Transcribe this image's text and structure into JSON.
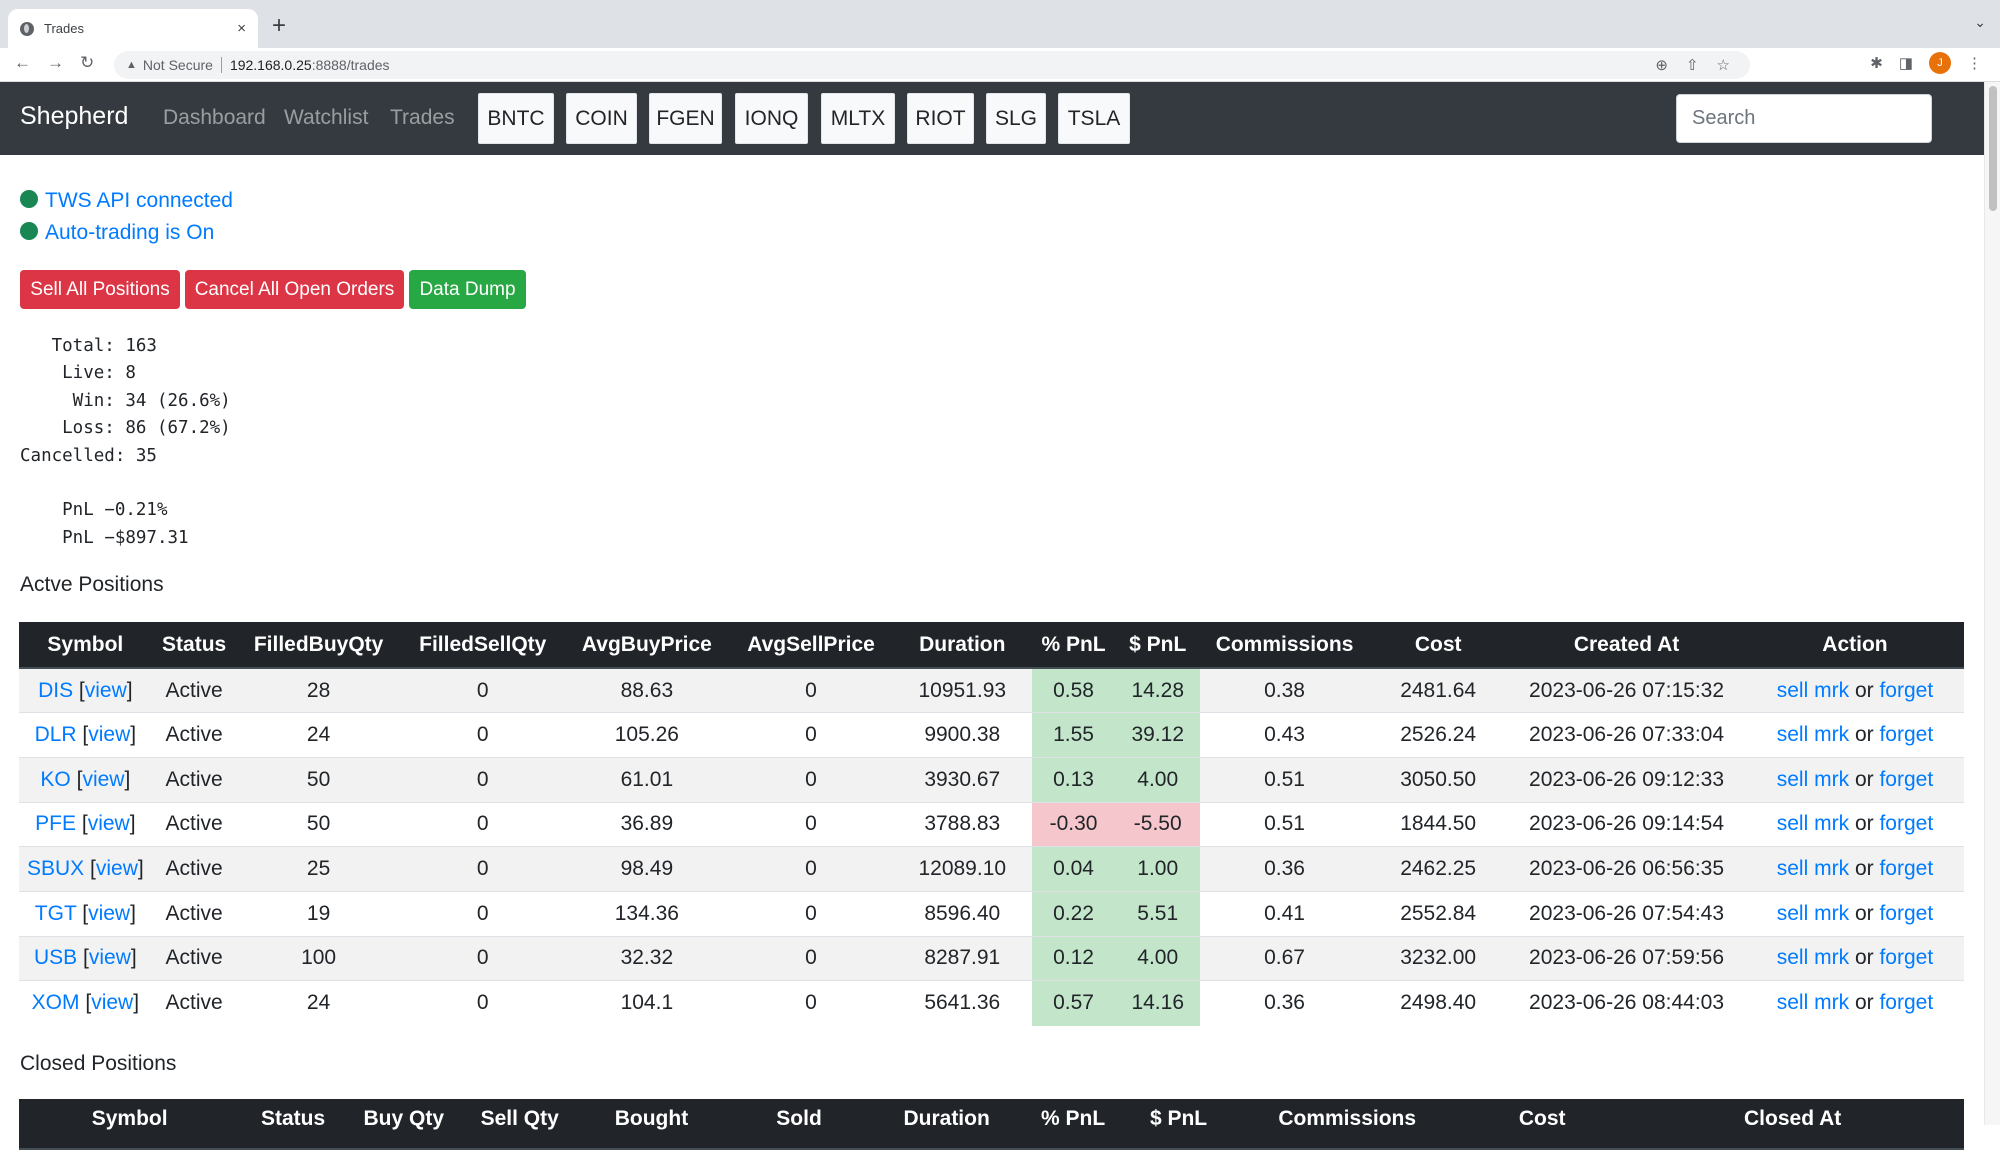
{
  "browser": {
    "tab_title": "Trades",
    "tab_close": "×",
    "new_tab": "+",
    "tab_menu": "⌄",
    "back": "←",
    "forward": "→",
    "reload": "↻",
    "security_icon": "▲",
    "security_label": "Not Secure",
    "url_host": "192.168.0.25",
    "url_rest": ":8888/trades",
    "zoom_icon": "⊕",
    "share_icon": "⇧",
    "star_icon": "☆",
    "extensions_icon": "✱",
    "sidepanel_icon": "◨",
    "profile_initial": "J",
    "menu_icon": "⋮"
  },
  "navbar": {
    "brand": "Shepherd",
    "links": [
      "Dashboard",
      "Watchlist",
      "Trades"
    ],
    "tickers": [
      "BNTC",
      "COIN",
      "FGEN",
      "IONQ",
      "MLTX",
      "RIOT",
      "SLG",
      "TSLA"
    ],
    "search_placeholder": "Search"
  },
  "status": {
    "api": "TWS API connected",
    "autotrading": "Auto-trading is On",
    "indicator_color": "#198754"
  },
  "actions": {
    "sell_all": "Sell All Positions",
    "cancel_all": "Cancel All Open Orders",
    "data_dump": "Data Dump"
  },
  "stats": {
    "total": "   Total: 163",
    "live": "    Live: 8",
    "win": "     Win: 34 (26.6%)",
    "loss": "    Loss: 86 (67.2%)",
    "cancelled": "Cancelled: 35",
    "pnl_pct": "    PnL −0.21%",
    "pnl_usd": "    PnL −$897.31"
  },
  "active": {
    "title": "Actve Positions",
    "columns": [
      "Symbol",
      "Status",
      "FilledBuyQty",
      "FilledSellQty",
      "AvgBuyPrice",
      "AvgSellPrice",
      "Duration",
      "% PnL",
      "$ PnL",
      "Commissions",
      "Cost",
      "Created At",
      "Action"
    ],
    "view_label": "view",
    "sell_label": "sell mrk",
    "or_label": "or",
    "forget_label": "forget",
    "rows": [
      {
        "symbol": "DIS",
        "status": "Active",
        "buy_qty": "28",
        "sell_qty": "0",
        "avg_buy": "88.63",
        "avg_sell": "0",
        "duration": "10951.93",
        "pnl_pct": "0.58",
        "pnl_usd": "14.28",
        "commissions": "0.38",
        "cost": "2481.64",
        "created": "2023-06-26 07:15:32"
      },
      {
        "symbol": "DLR",
        "status": "Active",
        "buy_qty": "24",
        "sell_qty": "0",
        "avg_buy": "105.26",
        "avg_sell": "0",
        "duration": "9900.38",
        "pnl_pct": "1.55",
        "pnl_usd": "39.12",
        "commissions": "0.43",
        "cost": "2526.24",
        "created": "2023-06-26 07:33:04"
      },
      {
        "symbol": "KO",
        "status": "Active",
        "buy_qty": "50",
        "sell_qty": "0",
        "avg_buy": "61.01",
        "avg_sell": "0",
        "duration": "3930.67",
        "pnl_pct": "0.13",
        "pnl_usd": "4.00",
        "commissions": "0.51",
        "cost": "3050.50",
        "created": "2023-06-26 09:12:33"
      },
      {
        "symbol": "PFE",
        "status": "Active",
        "buy_qty": "50",
        "sell_qty": "0",
        "avg_buy": "36.89",
        "avg_sell": "0",
        "duration": "3788.83",
        "pnl_pct": "-0.30",
        "pnl_usd": "-5.50",
        "commissions": "0.51",
        "cost": "1844.50",
        "created": "2023-06-26 09:14:54"
      },
      {
        "symbol": "SBUX",
        "status": "Active",
        "buy_qty": "25",
        "sell_qty": "0",
        "avg_buy": "98.49",
        "avg_sell": "0",
        "duration": "12089.10",
        "pnl_pct": "0.04",
        "pnl_usd": "1.00",
        "commissions": "0.36",
        "cost": "2462.25",
        "created": "2023-06-26 06:56:35"
      },
      {
        "symbol": "TGT",
        "status": "Active",
        "buy_qty": "19",
        "sell_qty": "0",
        "avg_buy": "134.36",
        "avg_sell": "0",
        "duration": "8596.40",
        "pnl_pct": "0.22",
        "pnl_usd": "5.51",
        "commissions": "0.41",
        "cost": "2552.84",
        "created": "2023-06-26 07:54:43"
      },
      {
        "symbol": "USB",
        "status": "Active",
        "buy_qty": "100",
        "sell_qty": "0",
        "avg_buy": "32.32",
        "avg_sell": "0",
        "duration": "8287.91",
        "pnl_pct": "0.12",
        "pnl_usd": "4.00",
        "commissions": "0.67",
        "cost": "3232.00",
        "created": "2023-06-26 07:59:56"
      },
      {
        "symbol": "XOM",
        "status": "Active",
        "buy_qty": "24",
        "sell_qty": "0",
        "avg_buy": "104.1",
        "avg_sell": "0",
        "duration": "5641.36",
        "pnl_pct": "0.57",
        "pnl_usd": "14.16",
        "commissions": "0.36",
        "cost": "2498.40",
        "created": "2023-06-26 08:44:03"
      }
    ],
    "positive_color": "#c3e6cb",
    "negative_color": "#f5c6cb"
  },
  "closed": {
    "title": "Closed Positions",
    "columns": [
      "Symbol",
      "Status",
      "Buy Qty",
      "Sell Qty",
      "Bought",
      "Sold",
      "Duration",
      "% PnL",
      "$ PnL",
      "Commissions",
      "Cost",
      "Closed At"
    ]
  }
}
